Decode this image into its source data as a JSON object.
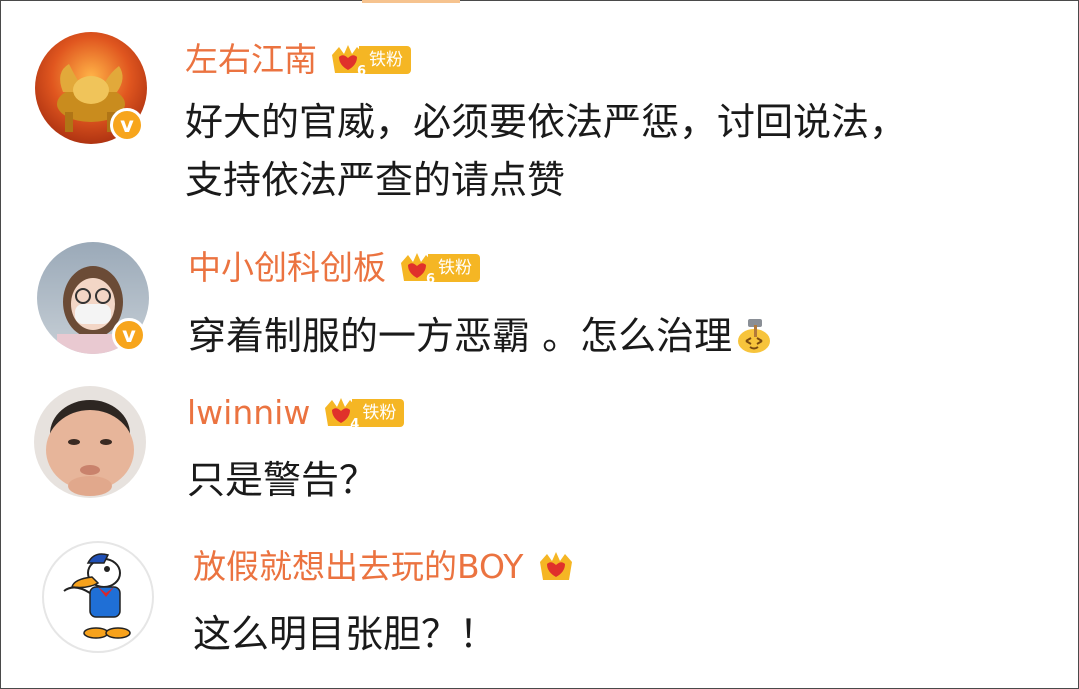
{
  "fan_label": "铁粉",
  "verified_mark": "v",
  "comments": [
    {
      "username": "左右江南",
      "fan_level": "6",
      "verified": true,
      "avatar_icon": "golden-bull-avatar",
      "lines": [
        "好大的官威，必须要依法严惩，讨回说法，",
        "支持依法严查的请点赞"
      ]
    },
    {
      "username": "中小创科创板",
      "fan_level": "6",
      "verified": true,
      "avatar_icon": "girl-with-mask-avatar",
      "lines": [
        "穿着制服的一方恶霸 。怎么治理"
      ],
      "emoji": "hammer-face-emoji"
    },
    {
      "username": "lwinniw",
      "fan_level": "4",
      "verified": false,
      "avatar_icon": "chubby-baby-avatar",
      "lines": [
        "只是警告？"
      ]
    },
    {
      "username": "放假就想出去玩的BOY",
      "fan_level": "",
      "verified": false,
      "avatar_icon": "donald-duck-avatar",
      "lines": [
        "这么明目张胆？！"
      ]
    }
  ],
  "colors": {
    "username": "#eb7340",
    "badge_gold": "#f5b624",
    "badge_red": "#e0312b",
    "verified": "#f7a51c",
    "text": "#1a1a1a"
  }
}
